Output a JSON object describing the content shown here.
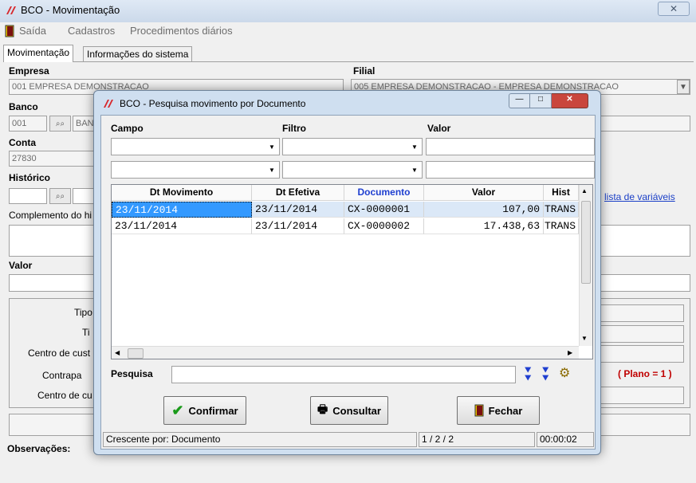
{
  "window": {
    "title": "BCO - Movimentação",
    "close_glyph": "✕"
  },
  "menu": {
    "items": [
      "Saída",
      "Cadastros",
      "Procedimentos diários"
    ]
  },
  "tabs": [
    "Movimentação",
    "Informações do sistema"
  ],
  "form": {
    "empresa_label": "Empresa",
    "empresa_value": "001 EMPRESA DEMONSTRACAO",
    "filial_label": "Filial",
    "filial_value": "005 EMPRESA DEMONSTRACAO - EMPRESA DEMONSTRACAO",
    "banco_label": "Banco",
    "banco_code": "001",
    "banco_name_partial": "BAN",
    "conta_label": "Conta",
    "conta_value": "27830",
    "historico_label": "Histórico",
    "complemento_label": "Complemento do hi",
    "lista_variaveis_link": "lista de variáveis",
    "valor_label": "Valor",
    "tipo_label": "Tipo",
    "ti_label": "Ti",
    "centro_custo_label": "Centro de cust",
    "contrapartida_label": "Contrapa",
    "centro_custo2_label": "Centro de cu",
    "plano_text": "( Plano = 1 )",
    "observacoes_label": "Observações:"
  },
  "dialog": {
    "title": "BCO - Pesquisa movimento por Documento",
    "filter_headers": {
      "campo": "Campo",
      "filtro": "Filtro",
      "valor": "Valor"
    },
    "grid_columns": [
      "Dt Movimento",
      "Dt Efetiva",
      "Documento",
      "Valor",
      "Hist"
    ],
    "grid_rows": [
      [
        "23/11/2014",
        "23/11/2014",
        "CX-0000001",
        "107,00",
        "TRANS"
      ],
      [
        "23/11/2014",
        "23/11/2014",
        "CX-0000002",
        "17.438,63",
        "TRANS"
      ]
    ],
    "pesquisa_label": "Pesquisa",
    "pesquisa_value": "",
    "buttons": {
      "confirmar": "Confirmar",
      "consultar": "Consultar",
      "fechar": "Fechar"
    },
    "status": {
      "order": "Crescente por: Documento",
      "position": "1 / 2 / 2",
      "time": "00:00:02"
    }
  },
  "colors": {
    "highlight_column": "#1f3fd0",
    "selected_row": "#dbe8f7",
    "selected_cell": "#3399ff",
    "plano_red": "#c00000",
    "close_red": "#c9463d"
  }
}
